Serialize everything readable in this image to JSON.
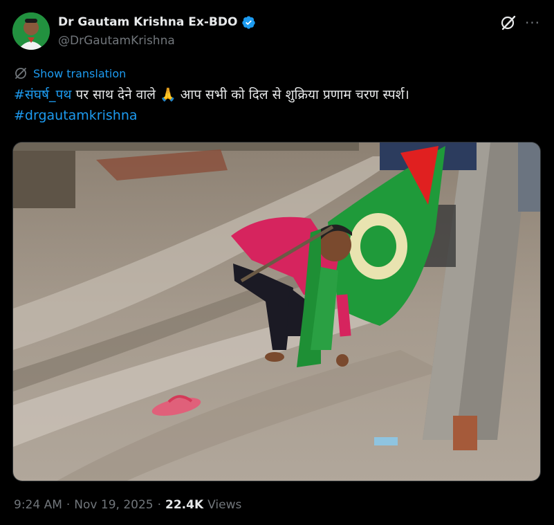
{
  "author": {
    "display_name": "Dr Gautam Krishna Ex-BDO",
    "handle": "@DrGautamKrishna",
    "verified": true
  },
  "actions": {
    "grok_icon": "grok-slash-icon",
    "more_icon": "more-horizontal-icon",
    "more_glyph": "···"
  },
  "translation": {
    "label": "Show translation",
    "icon": "translate-icon"
  },
  "tweet": {
    "hashtag1": "#संघर्ष_पथ",
    "text": " पर साथ देने वाले 🙏 आप सभी को दिल से शुक्रिया प्रणाम चरण स्पर्श।",
    "hashtag2": "#drgautamkrishna"
  },
  "media": {
    "type": "photo",
    "subject": "man bending in muddy road holding green flag"
  },
  "meta": {
    "time": "9:24 AM",
    "separator1": "·",
    "date": "Nov 19, 2025",
    "separator2": "·",
    "views_count": "22.4K",
    "views_label": "Views"
  },
  "colors": {
    "background": "#000000",
    "text": "#e7e9ea",
    "secondary": "#71767b",
    "link": "#1d9bf0",
    "verified": "#1d9bf0"
  }
}
